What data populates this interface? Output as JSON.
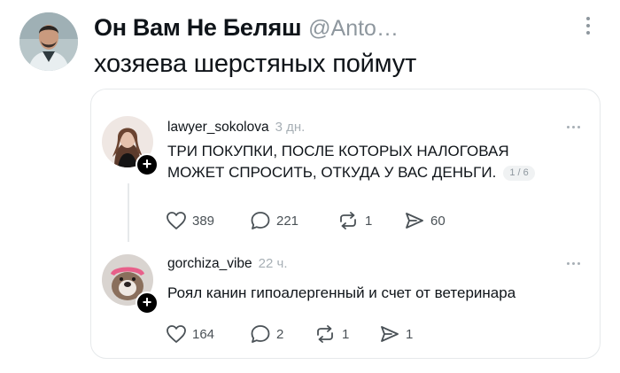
{
  "tweet": {
    "display_name": "Он Вам Не Беляш",
    "handle": "@Anto…",
    "text": "хозяева шерстяных поймут"
  },
  "quote": {
    "posts": [
      {
        "username": "lawyer_sokolova",
        "time": "3 дн.",
        "text_line1": "ТРИ ПОКУПКИ, ПОСЛЕ КОТОРЫХ НАЛОГОВАЯ",
        "text_line2": "МОЖЕТ СПРОСИТЬ, ОТКУДА У ВАС ДЕНЬГИ.",
        "page_badge": "1 / 6",
        "likes": "389",
        "replies": "221",
        "reposts": "1",
        "shares": "60"
      },
      {
        "username": "gorchiza_vibe",
        "time": "22 ч.",
        "text_line1": "Роял канин гипоалергенный и счет от ветеринара",
        "likes": "164",
        "replies": "2",
        "reposts": "1",
        "shares": "1"
      }
    ]
  },
  "icons": {
    "like": "heart-icon",
    "reply": "speech-bubble-icon",
    "repost": "repost-icon",
    "share": "send-icon",
    "more": "more-dots-icon",
    "follow": "plus-icon"
  },
  "colors": {
    "text": "#0f1419",
    "muted": "#8e979e",
    "border": "#e6e9eb"
  }
}
